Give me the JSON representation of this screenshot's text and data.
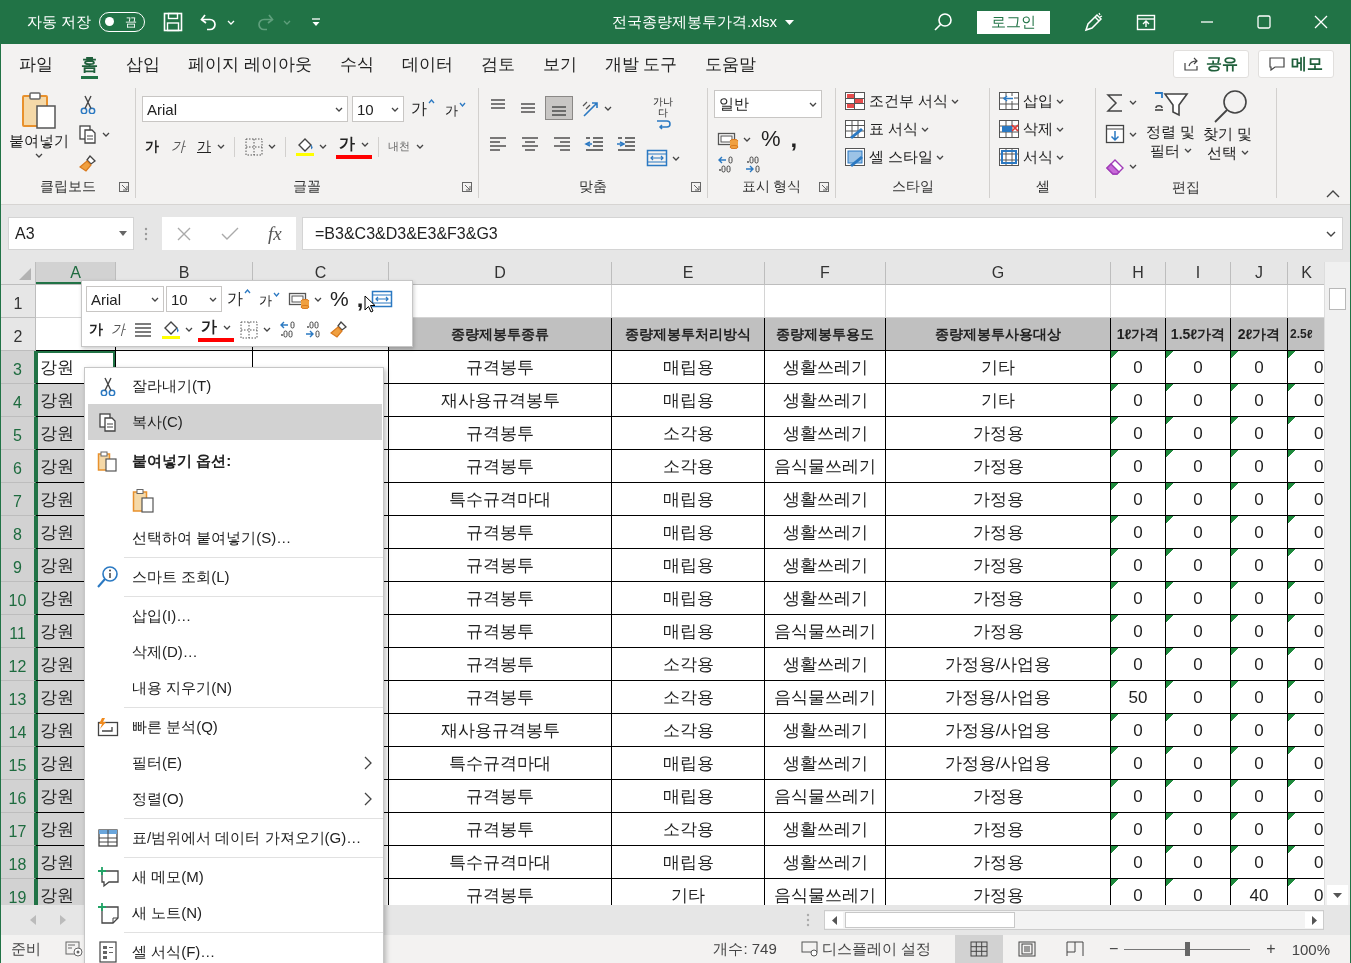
{
  "title_bar": {
    "autosave_label": "자동 저장",
    "autosave": {
      "on": false,
      "label": "끔"
    },
    "filename": "전국종량제봉투가격.xlsx",
    "sign_in": "로그인"
  },
  "tabs": [
    {
      "label": "파일",
      "selected": false
    },
    {
      "label": "홈",
      "selected": true
    },
    {
      "label": "삽입",
      "selected": false
    },
    {
      "label": "페이지 레이아웃",
      "selected": false
    },
    {
      "label": "수식",
      "selected": false
    },
    {
      "label": "데이터",
      "selected": false
    },
    {
      "label": "검토",
      "selected": false
    },
    {
      "label": "보기",
      "selected": false
    },
    {
      "label": "개발 도구",
      "selected": false
    },
    {
      "label": "도움말",
      "selected": false
    }
  ],
  "share_button": "공유",
  "comments_button": "메모",
  "ribbon": {
    "clipboard": {
      "paste": "붙여넣기",
      "label": "클립보드"
    },
    "font": {
      "font_name": "Arial",
      "font_size": "10",
      "grow": "가",
      "shrink": "가",
      "bold": "가",
      "italic": "가",
      "underline": "가",
      "font_color": "가",
      "phonetic": "내천",
      "label": "글꼴"
    },
    "alignment": {
      "vertical": [
        {
          "selected": false
        },
        {
          "selected": false
        },
        {
          "selected": true
        }
      ],
      "wrap": "가나다",
      "label": "맞춤"
    },
    "number": {
      "format": "일반",
      "percent": "%",
      "comma": ",",
      "label": "표시 형식"
    },
    "styles": {
      "items": [
        "조건부 서식",
        "표 서식",
        "셀 스타일"
      ],
      "label": "스타일"
    },
    "cells": {
      "items": [
        "삽입",
        "삭제",
        "서식"
      ],
      "label": "셀"
    },
    "editing": {
      "sort_filter": [
        "정렬 및",
        "필터"
      ],
      "find_select": [
        "찾기 및",
        "선택"
      ],
      "label": "편집"
    }
  },
  "formula_bar": {
    "name_box": "A3",
    "fx": "fx",
    "formula": "=B3&C3&D3&E3&F3&G3"
  },
  "sheet": {
    "columns": [
      {
        "letter": "A",
        "selected": true,
        "text_flag": false
      },
      {
        "letter": "B",
        "selected": false,
        "text_flag": false
      },
      {
        "letter": "C",
        "selected": false,
        "text_flag": false
      },
      {
        "letter": "D",
        "selected": false,
        "text_flag": false
      },
      {
        "letter": "E",
        "selected": false,
        "text_flag": false
      },
      {
        "letter": "F",
        "selected": false,
        "text_flag": false
      },
      {
        "letter": "G",
        "selected": false,
        "text_flag": false
      },
      {
        "letter": "H",
        "selected": false,
        "text_flag": true
      },
      {
        "letter": "I",
        "selected": false,
        "text_flag": true
      },
      {
        "letter": "J",
        "selected": false,
        "text_flag": true
      },
      {
        "letter": "K",
        "selected": false,
        "text_flag": true
      }
    ],
    "rows": [
      {
        "number": "1",
        "kind": "blank",
        "selected": false
      },
      {
        "number": "2",
        "kind": "header",
        "selected": false,
        "cells": {
          "D": "종량제봉투종류",
          "E": "종량제봉투처리방식",
          "F": "종량제봉투용도",
          "G": "종량제봉투사용대상",
          "H": "1ℓ가격",
          "I": "1.5ℓ가격",
          "J": "2ℓ가격",
          "K": "2.5ℓ"
        }
      },
      {
        "number": "3",
        "kind": "data",
        "selected": true,
        "cells": {
          "A": "강원",
          "D": "규격봉투",
          "E": "매립용",
          "F": "생활쓰레기",
          "G": "기타",
          "H": "0",
          "I": "0",
          "J": "0",
          "K": "0"
        }
      },
      {
        "number": "4",
        "kind": "data",
        "selected": true,
        "cells": {
          "A": "강원",
          "D": "재사용규격봉투",
          "E": "매립용",
          "F": "생활쓰레기",
          "G": "기타",
          "H": "0",
          "I": "0",
          "J": "0",
          "K": "0"
        }
      },
      {
        "number": "5",
        "kind": "data",
        "selected": true,
        "cells": {
          "A": "강원",
          "D": "규격봉투",
          "E": "소각용",
          "F": "생활쓰레기",
          "G": "가정용",
          "H": "0",
          "I": "0",
          "J": "0",
          "K": "0"
        }
      },
      {
        "number": "6",
        "kind": "data",
        "selected": true,
        "cells": {
          "A": "강원",
          "D": "규격봉투",
          "E": "소각용",
          "F": "음식물쓰레기",
          "G": "가정용",
          "H": "0",
          "I": "0",
          "J": "0",
          "K": "0"
        }
      },
      {
        "number": "7",
        "kind": "data",
        "selected": true,
        "cells": {
          "A": "강원",
          "D": "특수규격마대",
          "E": "매립용",
          "F": "생활쓰레기",
          "G": "가정용",
          "H": "0",
          "I": "0",
          "J": "0",
          "K": "0"
        }
      },
      {
        "number": "8",
        "kind": "data",
        "selected": true,
        "cells": {
          "A": "강원",
          "D": "규격봉투",
          "E": "매립용",
          "F": "생활쓰레기",
          "G": "가정용",
          "H": "0",
          "I": "0",
          "J": "0",
          "K": "0"
        }
      },
      {
        "number": "9",
        "kind": "data",
        "selected": true,
        "cells": {
          "A": "강원",
          "D": "규격봉투",
          "E": "매립용",
          "F": "생활쓰레기",
          "G": "가정용",
          "H": "0",
          "I": "0",
          "J": "0",
          "K": "0"
        }
      },
      {
        "number": "10",
        "kind": "data",
        "selected": true,
        "cells": {
          "A": "강원",
          "D": "규격봉투",
          "E": "매립용",
          "F": "생활쓰레기",
          "G": "가정용",
          "H": "0",
          "I": "0",
          "J": "0",
          "K": "0"
        }
      },
      {
        "number": "11",
        "kind": "data",
        "selected": true,
        "cells": {
          "A": "강원",
          "D": "규격봉투",
          "E": "매립용",
          "F": "음식물쓰레기",
          "G": "가정용",
          "H": "0",
          "I": "0",
          "J": "0",
          "K": "0"
        }
      },
      {
        "number": "12",
        "kind": "data",
        "selected": true,
        "cells": {
          "A": "강원",
          "D": "규격봉투",
          "E": "소각용",
          "F": "생활쓰레기",
          "G": "가정용/사업용",
          "H": "0",
          "I": "0",
          "J": "0",
          "K": "0"
        }
      },
      {
        "number": "13",
        "kind": "data",
        "selected": true,
        "cells": {
          "A": "강원",
          "D": "규격봉투",
          "E": "소각용",
          "F": "음식물쓰레기",
          "G": "가정용/사업용",
          "H": "50",
          "I": "0",
          "J": "0",
          "K": "0"
        }
      },
      {
        "number": "14",
        "kind": "data",
        "selected": true,
        "cells": {
          "A": "강원",
          "D": "재사용규격봉투",
          "E": "소각용",
          "F": "생활쓰레기",
          "G": "가정용/사업용",
          "H": "0",
          "I": "0",
          "J": "0",
          "K": "0"
        }
      },
      {
        "number": "15",
        "kind": "data",
        "selected": true,
        "cells": {
          "A": "강원",
          "D": "특수규격마대",
          "E": "매립용",
          "F": "생활쓰레기",
          "G": "가정용/사업용",
          "H": "0",
          "I": "0",
          "J": "0",
          "K": "0"
        }
      },
      {
        "number": "16",
        "kind": "data",
        "selected": true,
        "cells": {
          "A": "강원",
          "D": "규격봉투",
          "E": "매립용",
          "F": "음식물쓰레기",
          "G": "가정용",
          "H": "0",
          "I": "0",
          "J": "0",
          "K": "0"
        }
      },
      {
        "number": "17",
        "kind": "data",
        "selected": true,
        "cells": {
          "A": "강원",
          "D": "규격봉투",
          "E": "소각용",
          "F": "생활쓰레기",
          "G": "가정용",
          "H": "0",
          "I": "0",
          "J": "0",
          "K": "0"
        }
      },
      {
        "number": "18",
        "kind": "data",
        "selected": true,
        "cells": {
          "A": "강원",
          "D": "특수규격마대",
          "E": "매립용",
          "F": "생활쓰레기",
          "G": "가정용",
          "H": "0",
          "I": "0",
          "J": "0",
          "K": "0"
        }
      },
      {
        "number": "19",
        "kind": "data",
        "selected": true,
        "cells": {
          "A": "강원",
          "D": "규격봉투",
          "E": "기타",
          "F": "음식물쓰레기",
          "G": "가정용",
          "H": "0",
          "I": "0",
          "J": "40",
          "K": "0"
        }
      }
    ]
  },
  "mini_toolbar": {
    "font_name": "Arial",
    "font_size": "10",
    "grow": "가",
    "shrink": "가",
    "percent": "%",
    "comma": ",",
    "bold": "가",
    "italic": "가",
    "font_color": "가"
  },
  "context_menu": {
    "items": [
      {
        "kind": "item",
        "label": "잘라내기(T)",
        "selected": false,
        "submenu": false
      },
      {
        "kind": "item",
        "label": "복사(C)",
        "selected": true,
        "submenu": false
      },
      {
        "kind": "header",
        "label": "붙여넣기 옵션:"
      },
      {
        "kind": "paste_options"
      },
      {
        "kind": "item",
        "label": "선택하여 붙여넣기(S)…",
        "selected": false,
        "submenu": false
      },
      {
        "kind": "separator"
      },
      {
        "kind": "item",
        "label": "스마트 조회(L)",
        "selected": false,
        "submenu": false
      },
      {
        "kind": "separator"
      },
      {
        "kind": "item",
        "label": "삽입(I)…",
        "selected": false,
        "submenu": false
      },
      {
        "kind": "item",
        "label": "삭제(D)…",
        "selected": false,
        "submenu": false
      },
      {
        "kind": "item",
        "label": "내용 지우기(N)",
        "selected": false,
        "submenu": false
      },
      {
        "kind": "separator"
      },
      {
        "kind": "item",
        "label": "빠른 분석(Q)",
        "selected": false,
        "submenu": false
      },
      {
        "kind": "item",
        "label": "필터(E)",
        "selected": false,
        "submenu": true
      },
      {
        "kind": "item",
        "label": "정렬(O)",
        "selected": false,
        "submenu": true
      },
      {
        "kind": "separator"
      },
      {
        "kind": "item",
        "label": "표/범위에서 데이터 가져오기(G)…",
        "selected": false,
        "submenu": false
      },
      {
        "kind": "separator"
      },
      {
        "kind": "item",
        "label": "새 메모(M)",
        "selected": false,
        "submenu": false
      },
      {
        "kind": "item",
        "label": "새 노트(N)",
        "selected": false,
        "submenu": false
      },
      {
        "kind": "separator"
      },
      {
        "kind": "item",
        "label": "셀 서식(F)…",
        "selected": false,
        "submenu": false
      }
    ]
  },
  "status_bar": {
    "mode": "준비",
    "count": "개수: 749",
    "display_settings": "디스플레이 설정",
    "views": [
      {
        "selected": true
      },
      {
        "selected": false
      },
      {
        "selected": false
      }
    ],
    "zoom_out": "−",
    "zoom_in": "+",
    "zoom": {
      "level": 0.5
    },
    "zoom_percent": "100%"
  }
}
